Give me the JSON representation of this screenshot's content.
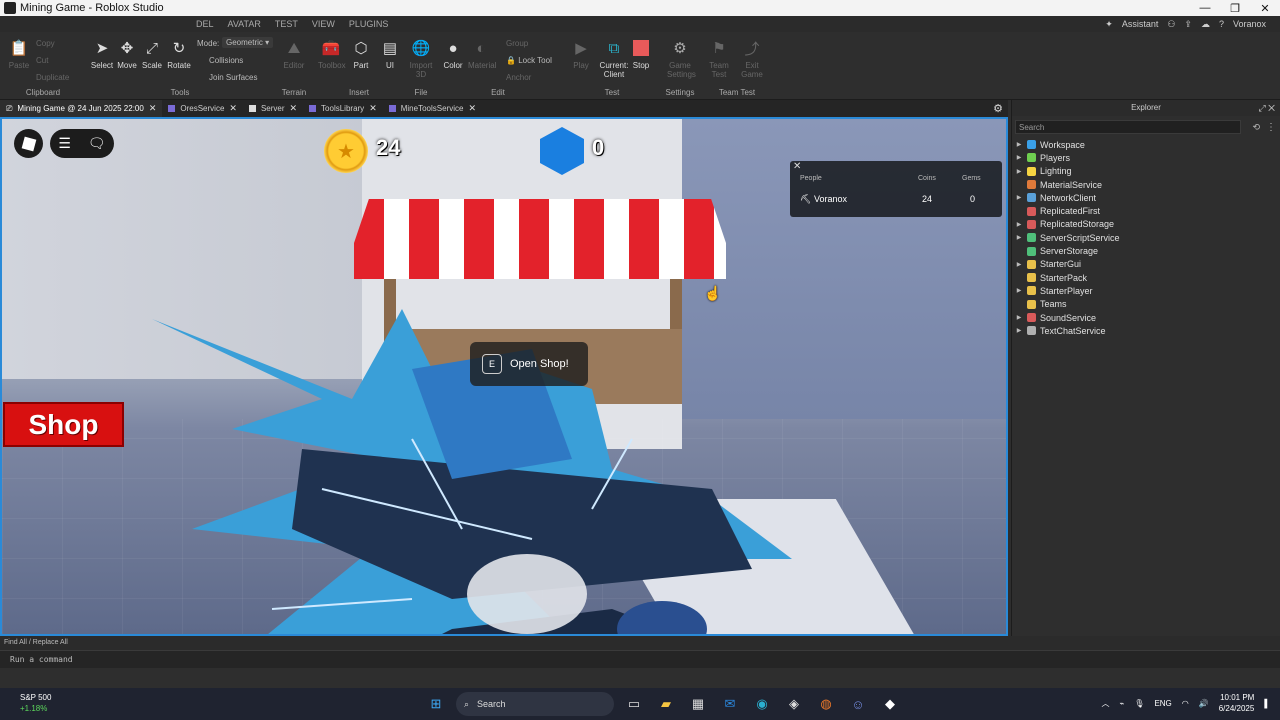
{
  "window": {
    "title": "Mining Game - Roblox Studio"
  },
  "menu": {
    "tabs": [
      "DEL",
      "AVATAR",
      "TEST",
      "VIEW",
      "PLUGINS"
    ],
    "assistant": "Assistant",
    "user": "Voranox"
  },
  "ribbon": {
    "clipboard": {
      "paste": "Paste",
      "copy": "Copy",
      "cut": "Cut",
      "duplicate": "Duplicate",
      "label": "Clipboard"
    },
    "tools": {
      "select": "Select",
      "move": "Move",
      "scale": "Scale",
      "rotate": "Rotate",
      "mode_label": "Mode:",
      "mode_value": "Geometric",
      "collisions": "Collisions",
      "join_surfaces": "Join Surfaces",
      "label": "Tools"
    },
    "terrain": {
      "editor": "Editor",
      "label": "Terrain"
    },
    "insert": {
      "toolbox": "Toolbox",
      "part": "Part",
      "ui": "UI",
      "label": "Insert"
    },
    "file": {
      "import3d": "Import 3D",
      "label": "File"
    },
    "edit": {
      "color": "Color",
      "material": "Material",
      "group": "Group",
      "lock_tool": "Lock Tool",
      "anchor": "Anchor",
      "label": "Edit"
    },
    "test": {
      "play": "Play",
      "current_client": "Current: Client",
      "stop": "Stop",
      "label": "Test"
    },
    "settings": {
      "game_settings": "Game Settings",
      "label": "Settings"
    },
    "team_test": {
      "team_test": "Team Test",
      "exit_game": "Exit Game",
      "label": "Team Test"
    }
  },
  "doc_tabs": [
    {
      "label": "Mining Game @ 24 Jun 2025 22:00",
      "type": "game"
    },
    {
      "label": "OresService",
      "type": "module"
    },
    {
      "label": "Server",
      "type": "script"
    },
    {
      "label": "ToolsLibrary",
      "type": "module"
    },
    {
      "label": "MineToolsService",
      "type": "module"
    }
  ],
  "game": {
    "coins": "24",
    "gems": "0",
    "prompt_key": "E",
    "prompt_text": "Open Shop!",
    "shop_button": "Shop",
    "leaderboard": {
      "headers": {
        "people": "People",
        "coins": "Coins",
        "gems": "Gems"
      },
      "rows": [
        {
          "name": "Voranox",
          "coins": "24",
          "gems": "0"
        }
      ]
    }
  },
  "explorer": {
    "title": "Explorer",
    "search_placeholder": "Search",
    "items": [
      {
        "label": "Workspace",
        "color": "#3aa0e8",
        "expandable": true
      },
      {
        "label": "Players",
        "color": "#6fcf50",
        "expandable": true
      },
      {
        "label": "Lighting",
        "color": "#f5d442",
        "expandable": true
      },
      {
        "label": "MaterialService",
        "color": "#e07a3a",
        "expandable": false
      },
      {
        "label": "NetworkClient",
        "color": "#5aa0d8",
        "expandable": true
      },
      {
        "label": "ReplicatedFirst",
        "color": "#d85a5a",
        "expandable": false
      },
      {
        "label": "ReplicatedStorage",
        "color": "#d85a5a",
        "expandable": true
      },
      {
        "label": "ServerScriptService",
        "color": "#4fbf7a",
        "expandable": true
      },
      {
        "label": "ServerStorage",
        "color": "#4fbf7a",
        "expandable": false
      },
      {
        "label": "StarterGui",
        "color": "#e8c04a",
        "expandable": true
      },
      {
        "label": "StarterPack",
        "color": "#e8c04a",
        "expandable": false
      },
      {
        "label": "StarterPlayer",
        "color": "#e8c04a",
        "expandable": true
      },
      {
        "label": "Teams",
        "color": "#e8c04a",
        "expandable": false
      },
      {
        "label": "SoundService",
        "color": "#d85a5a",
        "expandable": true
      },
      {
        "label": "TextChatService",
        "color": "#b0b0b0",
        "expandable": true
      }
    ]
  },
  "bottom": {
    "find_replace": "Find All / Replace All",
    "command_placeholder": "Run a command"
  },
  "taskbar": {
    "stock_name": "S&P 500",
    "stock_change": "+1.18%",
    "search_label": "Search",
    "lang": "ENG",
    "time": "10:01 PM",
    "date": "6/24/2025"
  }
}
